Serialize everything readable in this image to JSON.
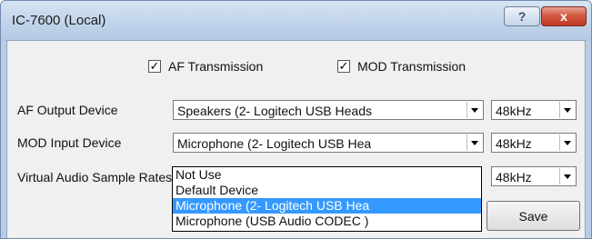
{
  "window": {
    "title": "IC-7600 (Local)",
    "help_glyph": "?",
    "close_glyph": "x"
  },
  "checkboxes": {
    "af_transmission": {
      "label": "AF Transmission",
      "checked": true,
      "mark": "✓"
    },
    "mod_transmission": {
      "label": "MOD Transmission",
      "checked": true,
      "mark": "✓"
    }
  },
  "rows": {
    "af_output": {
      "label": "AF Output Device",
      "device": "Speakers (2- Logitech USB Heads",
      "rate": "48kHz"
    },
    "mod_input": {
      "label": "MOD Input Device",
      "device": "Microphone (2- Logitech USB Hea",
      "rate": "48kHz"
    },
    "virtual_rate": {
      "label": "Virtual Audio Sample Rates",
      "rate": "48kHz"
    }
  },
  "dropdown": {
    "options": [
      "Not Use",
      "Default Device",
      "Microphone (2- Logitech USB Hea",
      "Microphone (USB Audio CODEC )"
    ],
    "selected_index": 2
  },
  "buttons": {
    "save": "Save"
  }
}
